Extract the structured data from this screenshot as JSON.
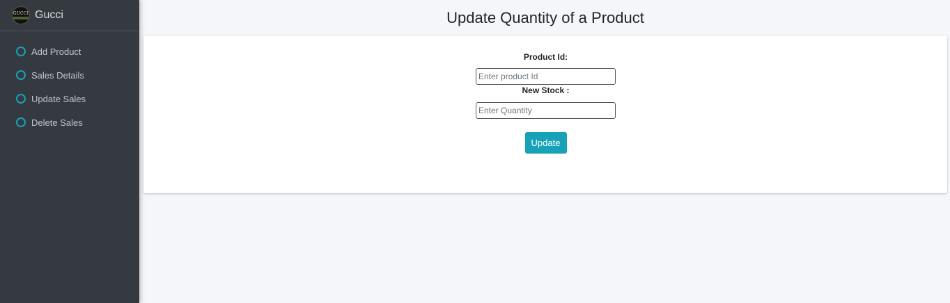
{
  "brand": {
    "name": "Gucci",
    "logo_text": "GUCCI"
  },
  "sidebar": {
    "items": [
      {
        "label": "Add Product"
      },
      {
        "label": "Sales Details"
      },
      {
        "label": "Update Sales"
      },
      {
        "label": "Delete Sales"
      }
    ]
  },
  "main": {
    "title": "Update Quantity of a Product"
  },
  "form": {
    "product_id_label": "Product Id:",
    "product_id_placeholder": "Enter product Id",
    "product_id_value": "",
    "new_stock_label": "New Stock :",
    "new_stock_placeholder": "Enter Quantity",
    "new_stock_value": "",
    "submit_label": "Update"
  },
  "colors": {
    "sidebar_bg": "#343a40",
    "accent": "#17a2b8",
    "page_bg": "#f4f6f9",
    "card_bg": "#ffffff"
  },
  "icons": {
    "nav_item": "circle-outline-icon"
  }
}
